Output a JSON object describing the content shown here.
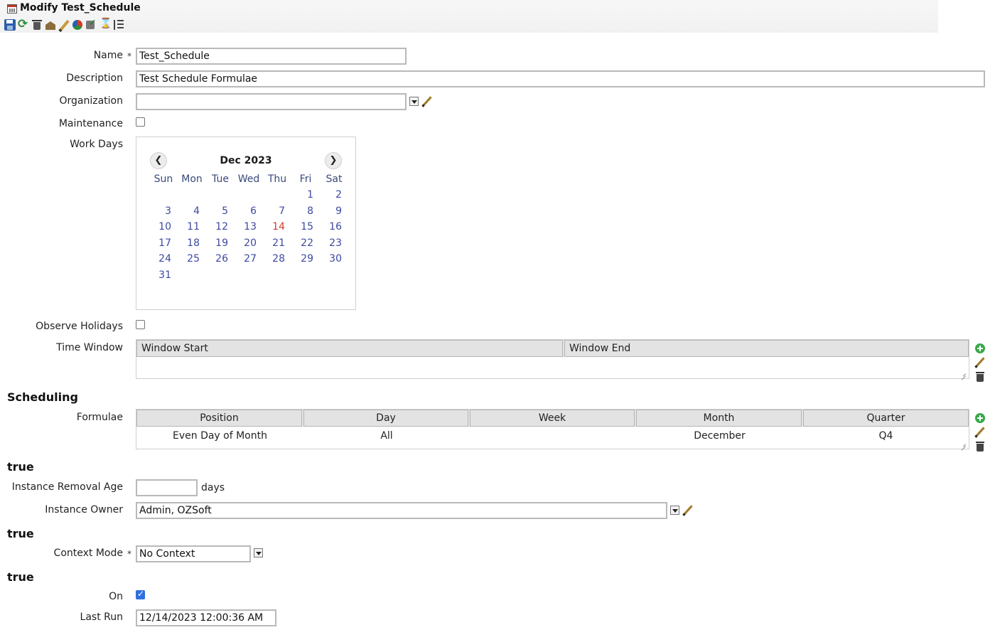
{
  "window": {
    "title": "Modify Test_Schedule"
  },
  "toolbar": {
    "icons": [
      "save-icon",
      "refresh-icon",
      "delete-icon",
      "generate-icon",
      "edit-icon",
      "reload-icon",
      "validate-icon",
      "hourglass-icon",
      "hierarchy-icon"
    ]
  },
  "form": {
    "name_label": "Name",
    "required_mark": "*",
    "name_value": "Test_Schedule",
    "description_label": "Description",
    "description_value": "Test Schedule Formulae",
    "organization_label": "Organization",
    "organization_value": "",
    "maintenance_label": "Maintenance",
    "maintenance_checked": false,
    "work_days_label": "Work Days",
    "observe_holidays_label": "Observe Holidays",
    "observe_holidays_checked": false,
    "time_window_label": "Time Window"
  },
  "calendar": {
    "title": "Dec 2023",
    "prev_glyph": "❮",
    "next_glyph": "❯",
    "weekdays": [
      "Sun",
      "Mon",
      "Tue",
      "Wed",
      "Thu",
      "Fri",
      "Sat"
    ],
    "weeks": [
      [
        "",
        "",
        "",
        "",
        "",
        "1",
        "2"
      ],
      [
        "3",
        "4",
        "5",
        "6",
        "7",
        "8",
        "9"
      ],
      [
        "10",
        "11",
        "12",
        "13",
        "14",
        "15",
        "16"
      ],
      [
        "17",
        "18",
        "19",
        "20",
        "21",
        "22",
        "23"
      ],
      [
        "24",
        "25",
        "26",
        "27",
        "28",
        "29",
        "30"
      ],
      [
        "31",
        "",
        "",
        "",
        "",
        "",
        ""
      ]
    ],
    "today": "14"
  },
  "time_window": {
    "columns": [
      "Window Start",
      "Window End"
    ]
  },
  "scheduling": {
    "section_title": "Scheduling",
    "formulae_label": "Formulae",
    "columns": [
      "Position",
      "Day",
      "Week",
      "Month",
      "Quarter"
    ],
    "rows": [
      [
        "Even Day of Month",
        "All",
        "",
        "December",
        "Q4"
      ]
    ]
  },
  "retention": {
    "section_title": "true",
    "removal_age_label": "Instance Removal Age",
    "removal_age_value": "",
    "removal_age_unit": "days",
    "owner_label": "Instance Owner",
    "owner_value": "Admin, OZSoft"
  },
  "context": {
    "section_title": "true",
    "mode_label": "Context Mode",
    "mode_value": "No Context"
  },
  "status": {
    "section_title": "true",
    "on_label": "On",
    "on_checked": true,
    "last_run_label": "Last Run",
    "last_run_value": "12/14/2023 12:00:36 AM"
  }
}
